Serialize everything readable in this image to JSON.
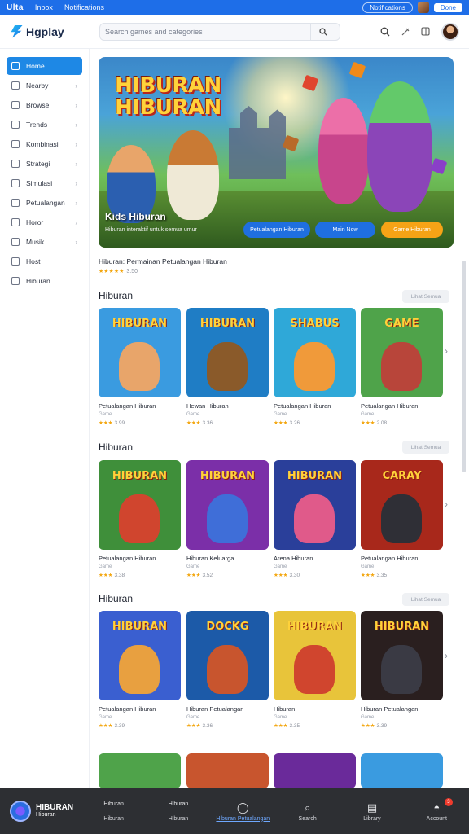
{
  "topbar": {
    "brand": "Ulta",
    "item1": "Inbox",
    "item2": "Notifications",
    "pill": "Notifications",
    "button": "Done"
  },
  "header": {
    "logo": "Hgplay",
    "search_placeholder": "Search games and categories",
    "search_icon": "search-icon"
  },
  "sidebar": {
    "items": [
      {
        "label": "Home",
        "active": true
      },
      {
        "label": "Nearby"
      },
      {
        "label": "Browse"
      },
      {
        "label": "Trends"
      },
      {
        "label": "Kombinasi"
      },
      {
        "label": "Strategi"
      },
      {
        "label": "Simulasi"
      },
      {
        "label": "Petualangan"
      },
      {
        "label": "Horor"
      },
      {
        "label": "Musik"
      },
      {
        "label": "Host"
      },
      {
        "label": "Hiburan"
      }
    ]
  },
  "hero": {
    "title_line1": "HIBURAN",
    "title_line2": "HIBURAN",
    "subtitle": "Kids Hiburan",
    "caption": "Hiburan interaktif untuk semua umur",
    "btn1": "Petualangan Hiburan",
    "btn2": "Main Now",
    "btn3": "Game Hiburan"
  },
  "featured": {
    "title": "Hiburan: Permainan Petualangan Hiburan",
    "stars": "★★★★★",
    "rating": "3.50"
  },
  "sections": [
    {
      "title": "Hiburan",
      "see_all": "Lihat Semua",
      "cards": [
        {
          "thumb_title": "HIBURAN",
          "name": "Petualangan Hiburan",
          "sub": "Game",
          "stars": "★★★",
          "rating": "3.99",
          "bg": "#3a9be0",
          "fig": "#e8a56a"
        },
        {
          "thumb_title": "HIBURAN",
          "name": "Hewan Hiburan",
          "sub": "Game",
          "stars": "★★★",
          "rating": "3.36",
          "bg": "#1f7dc5",
          "fig": "#8a5a2a"
        },
        {
          "thumb_title": "SHABUS",
          "name": "Petualangan Hiburan",
          "sub": "Game",
          "stars": "★★★",
          "rating": "3.26",
          "bg": "#2fa8d8",
          "fig": "#f09a3a"
        },
        {
          "thumb_title": "GAME",
          "name": "Petualangan Hiburan",
          "sub": "Game",
          "stars": "★★★",
          "rating": "2.08",
          "bg": "#4fa34a",
          "fig": "#b8453a"
        }
      ]
    },
    {
      "title": "Hiburan",
      "see_all": "Lihat Semua",
      "cards": [
        {
          "thumb_title": "HIBURAN",
          "name": "Petualangan Hiburan",
          "sub": "Game",
          "stars": "★★★",
          "rating": "3.38",
          "bg": "#3f8f3a",
          "fig": "#d0452e"
        },
        {
          "thumb_title": "HIBURAN",
          "name": "Hiburan Keluarga",
          "sub": "Game",
          "stars": "★★★",
          "rating": "3.52",
          "bg": "#7b2fa8",
          "fig": "#3f6ed8"
        },
        {
          "thumb_title": "HIBURAN",
          "name": "Arena Hiburan",
          "sub": "Game",
          "stars": "★★★",
          "rating": "3.30",
          "bg": "#2a3f9a",
          "fig": "#e05a8a"
        },
        {
          "thumb_title": "CARAY",
          "name": "Petualangan Hiburan",
          "sub": "Game",
          "stars": "★★★",
          "rating": "3.35",
          "bg": "#a8281b",
          "fig": "#2f2f36"
        }
      ]
    },
    {
      "title": "Hiburan",
      "see_all": "Lihat Semua",
      "cards": [
        {
          "thumb_title": "HIBURAN",
          "name": "Petualangan Hiburan",
          "sub": "Game",
          "stars": "★★★",
          "rating": "3.39",
          "bg": "#3a5fd0",
          "fig": "#e8a040"
        },
        {
          "thumb_title": "DOCKG",
          "name": "Hiburan Petualangan",
          "sub": "Game",
          "stars": "★★★",
          "rating": "3.36",
          "bg": "#1c5aa8",
          "fig": "#c8552e"
        },
        {
          "thumb_title": "HIBURAN",
          "name": "Hiburan",
          "sub": "Game",
          "stars": "★★★",
          "rating": "3.35",
          "bg": "#e8c43a",
          "fig": "#d0452e"
        },
        {
          "thumb_title": "HIBURAN",
          "name": "Hiburan Petualangan",
          "sub": "Game",
          "stars": "★★★",
          "rating": "3.39",
          "bg": "#2a1f1f",
          "fig": "#3a3a44"
        }
      ]
    }
  ],
  "bottom_nav": {
    "logo_title": "HIBURAN",
    "logo_sub": "Hiburan",
    "items": [
      {
        "top": "Hiburan",
        "label": "Hiburan"
      },
      {
        "top": "Hiburan",
        "label": "Hiburan"
      },
      {
        "label": "Hiburan Petualangan",
        "active": true
      },
      {
        "label": "Search"
      },
      {
        "label": "Library"
      },
      {
        "label": "Account",
        "badge": "3"
      }
    ]
  },
  "colors": {
    "accent": "#1e88e5",
    "topbar": "#1e6ee8",
    "bottom_bg": "#2d2f33",
    "star": "#f3a60f"
  }
}
